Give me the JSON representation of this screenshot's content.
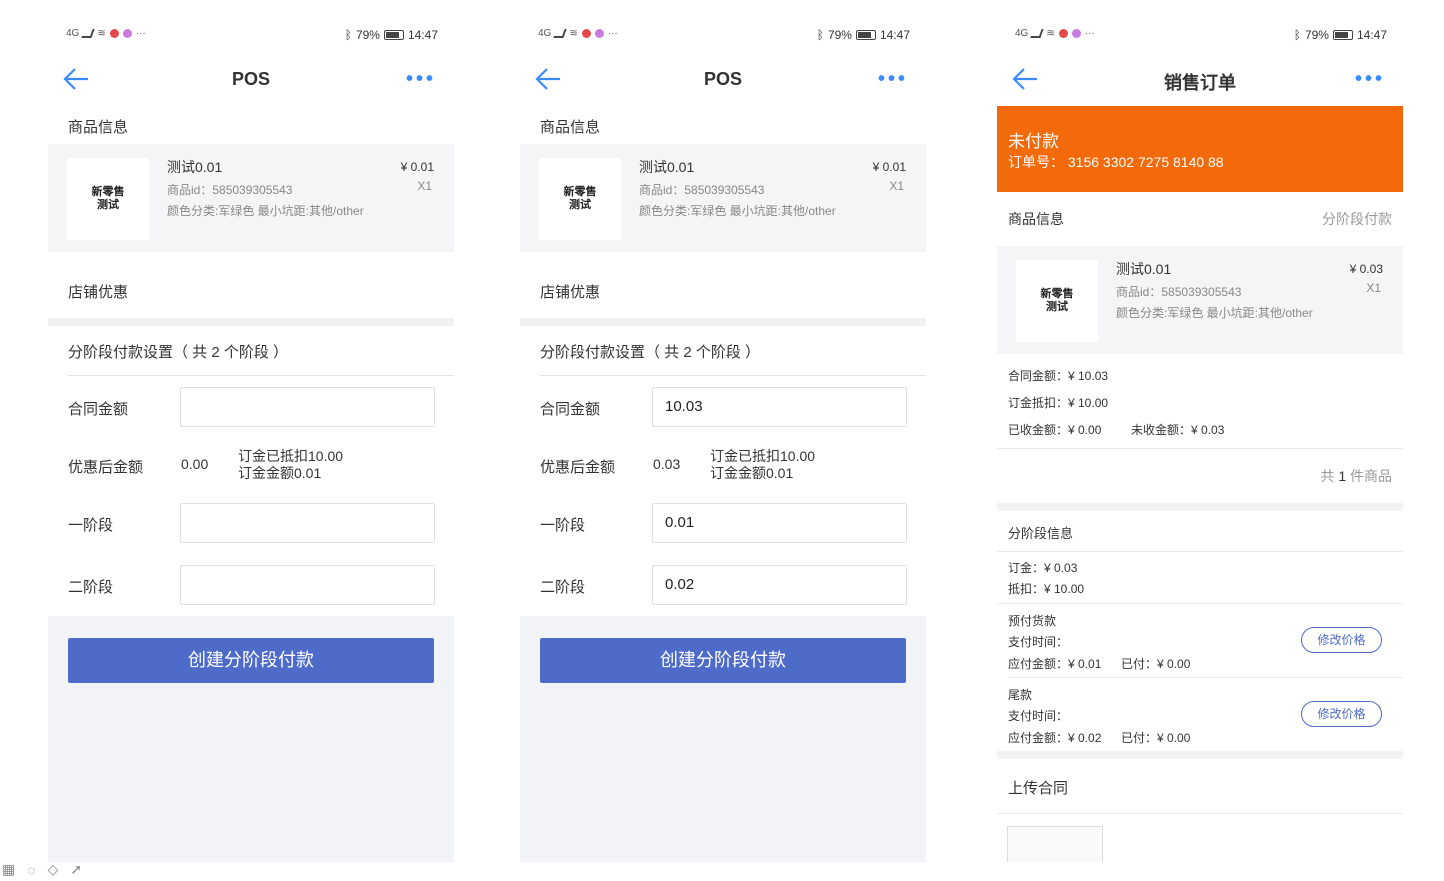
{
  "status": {
    "left_text": "4G",
    "battery": "79%",
    "time": "14:47"
  },
  "screens": [
    {
      "title": "POS",
      "goods_section": "商品信息",
      "goods": {
        "thumb_line1": "新零售",
        "thumb_line2": "测试",
        "name": "测试0.01",
        "id": "商品id：585039305543",
        "attr": "颜色分类:军绿色 最小坑距:其他/other",
        "price": "¥ 0.01",
        "qty": "X1"
      },
      "shop_discount": "店铺优惠",
      "stage_title": "分阶段付款设置（ 共 2 个阶段 ）",
      "contract_label": "合同金额",
      "contract_value": "",
      "after_label": "优惠后金额",
      "after_value": "0.00",
      "note1": "订金已抵扣10.00",
      "note2": "订金金额0.01",
      "stage1_label": "一阶段",
      "stage1_value": "",
      "stage2_label": "二阶段",
      "stage2_value": "",
      "button": "创建分阶段付款"
    },
    {
      "title": "POS",
      "goods_section": "商品信息",
      "goods": {
        "thumb_line1": "新零售",
        "thumb_line2": "测试",
        "name": "测试0.01",
        "id": "商品id：585039305543",
        "attr": "颜色分类:军绿色 最小坑距:其他/other",
        "price": "¥ 0.01",
        "qty": "X1"
      },
      "shop_discount": "店铺优惠",
      "stage_title": "分阶段付款设置（ 共 2 个阶段 ）",
      "contract_label": "合同金额",
      "contract_value": "10.03",
      "after_label": "优惠后金额",
      "after_value": "0.03",
      "note1": "订金已抵扣10.00",
      "note2": "订金金额0.01",
      "stage1_label": "一阶段",
      "stage1_value": "0.01",
      "stage2_label": "二阶段",
      "stage2_value": "0.02",
      "button": "创建分阶段付款"
    }
  ],
  "order": {
    "title": "销售订单",
    "status": "未付款",
    "order_no": "订单号： 3156 3302 7275 8140 88",
    "goods_section": "商品信息",
    "pay_type": "分阶段付款",
    "goods": {
      "thumb_line1": "新零售",
      "thumb_line2": "测试",
      "name": "测试0.01",
      "id": "商品id：585039305543",
      "attr": "颜色分类:军绿色 最小坑距:其他/other",
      "price": "¥ 0.03",
      "qty": "X1"
    },
    "contract": "合同金额：¥ 10.03",
    "deposit_deduct": "订金抵扣：¥ 10.00",
    "received": "已收金额：¥ 0.00",
    "unreceived": "未收金额：¥ 0.03",
    "total_prefix": "共",
    "total_count": "1",
    "total_suffix": "件商品",
    "stage_info": "分阶段信息",
    "deposit": "订金：¥ 0.03",
    "deduct": "抵扣：¥ 10.00",
    "stages": [
      {
        "name": "预付货款",
        "time": "支付时间：",
        "due": "应付金额：¥ 0.01",
        "paid": "已付：¥ 0.00",
        "btn": "修改价格"
      },
      {
        "name": "尾款",
        "time": "支付时间：",
        "due": "应付金额：¥ 0.02",
        "paid": "已付：¥ 0.00",
        "btn": "修改价格"
      }
    ],
    "upload": "上传合同"
  }
}
